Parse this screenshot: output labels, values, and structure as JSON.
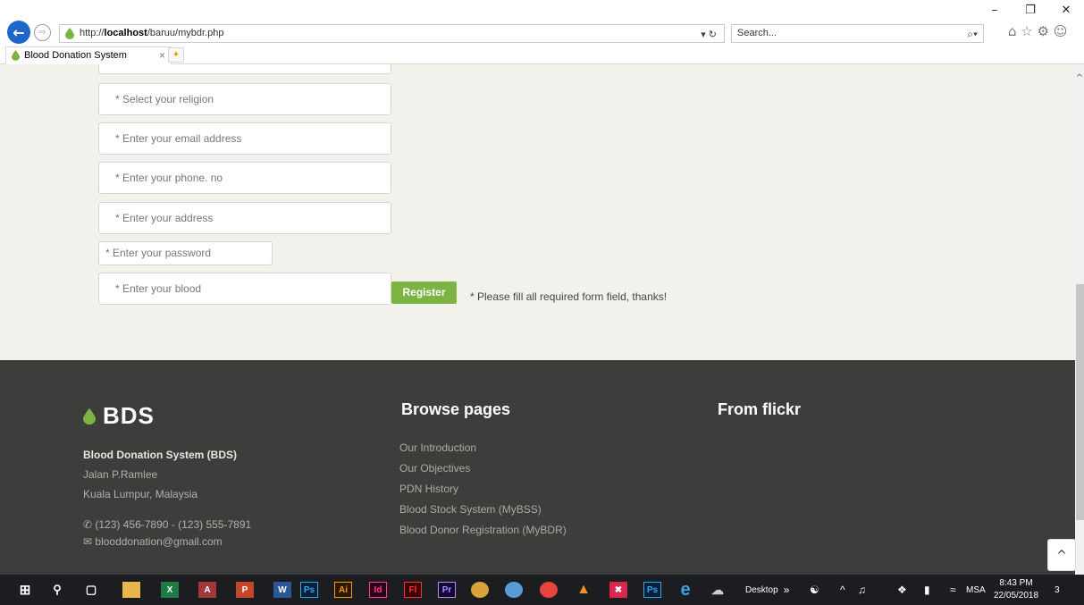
{
  "window": {
    "minimize": "–",
    "restore": "❐",
    "close": "✕"
  },
  "browser": {
    "url_prefix": "http://",
    "url_host": "localhost",
    "url_path": "/baruu/mybdr.php",
    "url_tools": "▾ ↻",
    "search_placeholder": "Search...",
    "search_icon": "⌕▾",
    "fav_icons": "⌂ ☆ ⚙ ☺",
    "tab_title": "Blood Donation System",
    "tab_close": "×",
    "new_tab": "✦"
  },
  "form": {
    "religion_placeholder": "* Select your religion",
    "email_placeholder": "* Enter your email address",
    "phone_placeholder": "* Enter your phone. no",
    "address_placeholder": "* Enter your address",
    "password_placeholder": "* Enter your password",
    "blood_placeholder": "* Enter your blood",
    "register_label": "Register",
    "note": "* Please fill all required form field, thanks!"
  },
  "footer": {
    "logo_text": "BDS",
    "org_name": "Blood Donation System (BDS)",
    "address_line1": "Jalan P.Ramlee",
    "address_line2": "Kuala Lumpur, Malaysia",
    "phone": "(123) 456-7890 - (123) 555-7891",
    "email": "blooddonation@gmail.com",
    "browse_heading": "Browse pages",
    "links": [
      "Our Introduction",
      "Our Objectives",
      "PDN History",
      "Blood Stock System (MyBSS)",
      "Blood Donor Registration (MyBDR)"
    ],
    "flickr_heading": "From flickr"
  },
  "to_top": "^",
  "taskbar": {
    "desktop_label": "Desktop",
    "tray_lang": "MSA",
    "time": "8:43 PM",
    "date": "22/05/2018",
    "notifications": "3"
  },
  "colors": {
    "accent_green": "#7cb342",
    "footer_bg": "#3d3d3b",
    "page_bg": "#f3f1ec",
    "ie_blue": "#1e66c9"
  }
}
